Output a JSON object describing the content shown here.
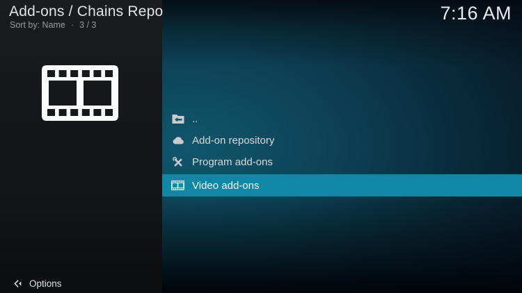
{
  "header": {
    "title": "Add-ons / Chains Repo",
    "sort_label": "Sort by: Name",
    "separator": "·",
    "count": "3 / 3",
    "clock": "7:16 AM"
  },
  "sidebar": {
    "thumbnail_icon": "film-strip-icon"
  },
  "list": {
    "items": [
      {
        "label": "..",
        "icon": "folder-back-icon",
        "selected": false
      },
      {
        "label": "Add-on repository",
        "icon": "cloud-icon",
        "selected": false
      },
      {
        "label": "Program add-ons",
        "icon": "tools-icon",
        "selected": false
      },
      {
        "label": "Video add-ons",
        "icon": "film-icon",
        "selected": true
      }
    ]
  },
  "footer": {
    "options_label": "Options"
  },
  "colors": {
    "highlight": "#1187a6",
    "sidebar_bg": "#15181b",
    "glow_teal": "#0e4a5e"
  }
}
